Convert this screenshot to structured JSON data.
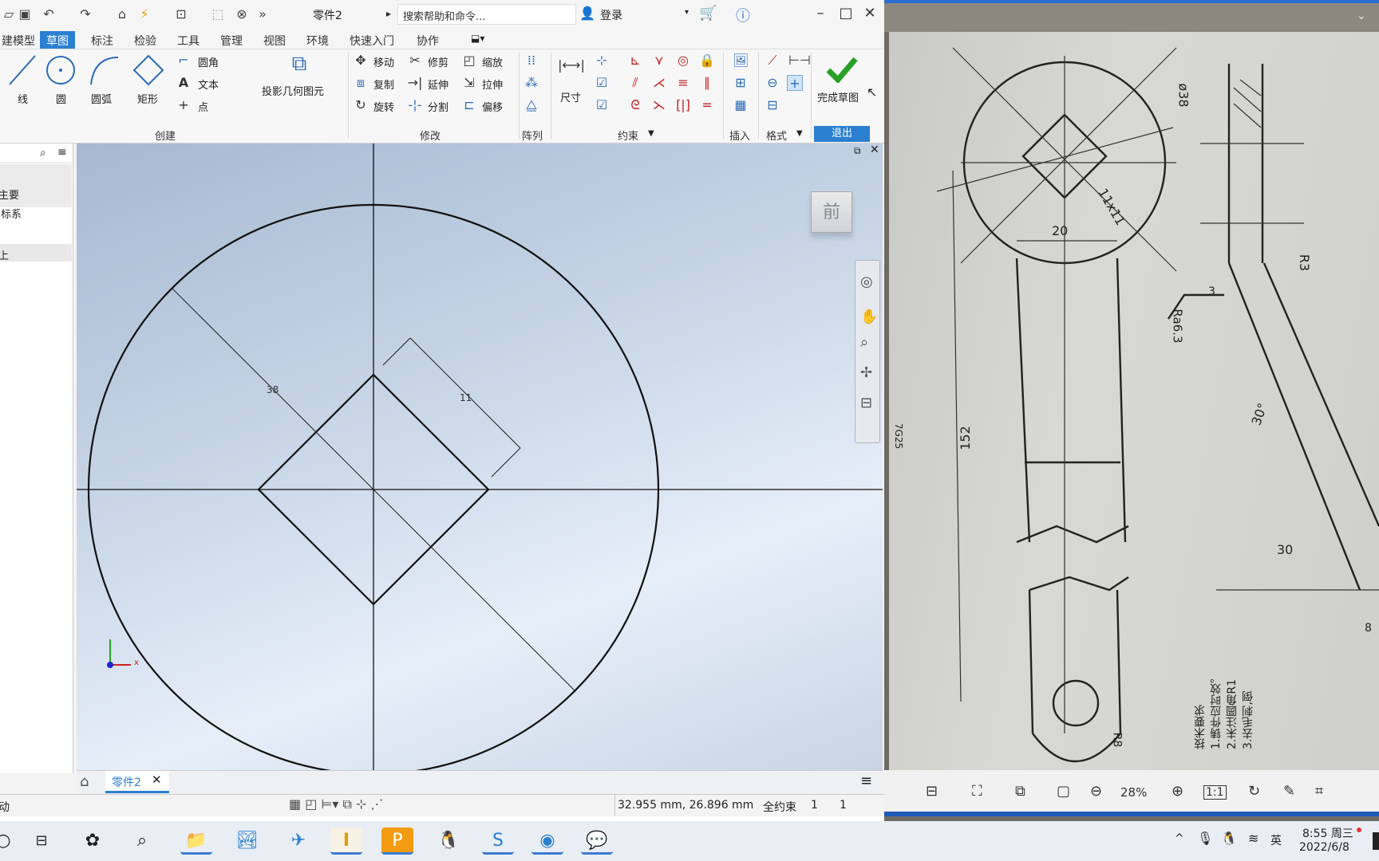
{
  "app": {
    "doc_title": "零件2",
    "search_placeholder": "搜索帮助和命令...",
    "login": "登录"
  },
  "menu_tabs": [
    "建模型",
    "草图",
    "标注",
    "检验",
    "工具",
    "管理",
    "视图",
    "环境",
    "快速入门",
    "协作"
  ],
  "ribbon": {
    "create": {
      "title": "创建",
      "line": "线",
      "circle": "圆",
      "arc": "圆弧",
      "rect": "矩形",
      "fillet": "圆角",
      "text": "文本",
      "point": "点",
      "project": "投影几何图元"
    },
    "modify": {
      "title": "修改",
      "move": "移动",
      "trim": "修剪",
      "scale": "缩放",
      "copy": "复制",
      "extend": "延伸",
      "stretch": "拉伸",
      "rotate": "旋转",
      "split": "分割",
      "offset": "偏移"
    },
    "pattern": {
      "title": "阵列"
    },
    "constrain": {
      "title": "约束",
      "dimension": "尺寸"
    },
    "insert": {
      "title": "插入"
    },
    "format": {
      "title": "格式"
    },
    "exit": {
      "finish": "完成草图",
      "title": "退出"
    }
  },
  "browser": {
    "items": [
      "主要",
      "坐标系",
      "上"
    ]
  },
  "sketch": {
    "dim_diameter": "38",
    "dim_square": "11",
    "viewcube_face": "前",
    "axis_x": "x"
  },
  "doc_tab": "零件2",
  "status": {
    "left": "动",
    "coords": "32.955 mm, 26.896 mm",
    "constraint": "全约束",
    "n1": "1",
    "n2": "1"
  },
  "viewer": {
    "zoom": "28%"
  },
  "drawing_labels": {
    "d38": "ø38",
    "sq": "11x11",
    "w20": "20",
    "r3": "R3",
    "ra": "Ra6.3",
    "h152": "152",
    "a30": "30°",
    "w30": "30",
    "n3": "3",
    "n8": "8",
    "z7": "7G25",
    "r8": "R8",
    "notes": [
      "技术要求",
      "1.铸件应时效。",
      "2.未注圆角R1",
      "3.去毛刺,倒"
    ]
  },
  "taskbar": {
    "ime": "英",
    "time": "8:55 周三",
    "date": "2022/6/8"
  }
}
